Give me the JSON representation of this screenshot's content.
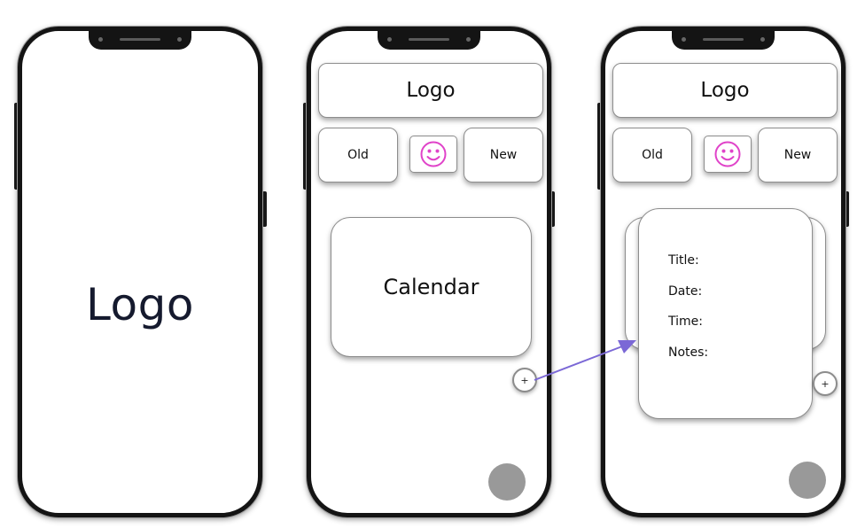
{
  "accent_color": "#e043c9",
  "arrow_color": "#7b68d6",
  "screens": [
    {
      "logo": "Logo"
    },
    {
      "header": "Logo",
      "old_label": "Old",
      "new_label": "New",
      "mood_icon": "smiley-icon",
      "calendar_label": "Calendar",
      "add_label": "+"
    },
    {
      "header": "Logo",
      "old_label": "Old",
      "new_label": "New",
      "mood_icon": "smiley-icon",
      "form": {
        "title_label": "Title:",
        "date_label": "Date:",
        "time_label": "Time:",
        "notes_label": "Notes:"
      },
      "add_label": "+"
    }
  ]
}
